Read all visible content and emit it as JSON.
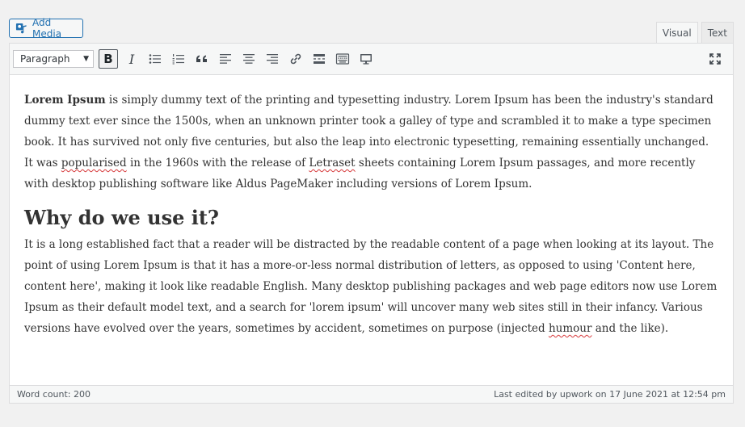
{
  "add_media": {
    "label": "Add Media",
    "icon": "media-icon"
  },
  "tabs": [
    {
      "label": "Visual",
      "active": true
    },
    {
      "label": "Text",
      "active": false
    }
  ],
  "toolbar": {
    "format_value": "Paragraph",
    "buttons": [
      "bold",
      "italic",
      "bulleted-list",
      "numbered-list",
      "blockquote",
      "align-left",
      "align-center",
      "align-right",
      "insert-link",
      "read-more",
      "toolbar-toggle",
      "distraction-free"
    ],
    "bold_label": "B",
    "italic_label": "I"
  },
  "content": {
    "p1_bold": "Lorem Ipsum",
    "p1_a": " is simply dummy text of the printing and typesetting industry. Lorem Ipsum has been the industry's standard dummy text ever since the 1500s, when an unknown printer took a galley of type and scrambled it to make a type specimen book. It has survived not only five centuries, but also the leap into electronic typesetting, remaining essentially unchanged. It was ",
    "p1_spell1": "popularised",
    "p1_b": " in the 1960s with the release of ",
    "p1_spell2": "Letraset",
    "p1_c": " sheets containing Lorem Ipsum passages, and more recently with desktop publishing software like Aldus PageMaker including versions of Lorem Ipsum.",
    "heading": "Why do we use it?",
    "p2_a": "It is a long established fact that a reader will be distracted by the readable content of a page when looking at its layout. The point of using Lorem Ipsum is that it has a more-or-less normal distribution of letters, as opposed to using 'Content here, content here', making it look like readable English. Many desktop publishing packages and web page editors now use Lorem Ipsum as their default model text, and a search for 'lorem ipsum' will uncover many web sites still in their infancy. Various versions have evolved over the years, sometimes by accident, sometimes on purpose (injected ",
    "p2_spell": "humour",
    "p2_b": " and the like)."
  },
  "status": {
    "word_count": "Word count: 200",
    "last_edited": "Last edited by upwork on 17 June 2021 at 12:54 pm"
  }
}
